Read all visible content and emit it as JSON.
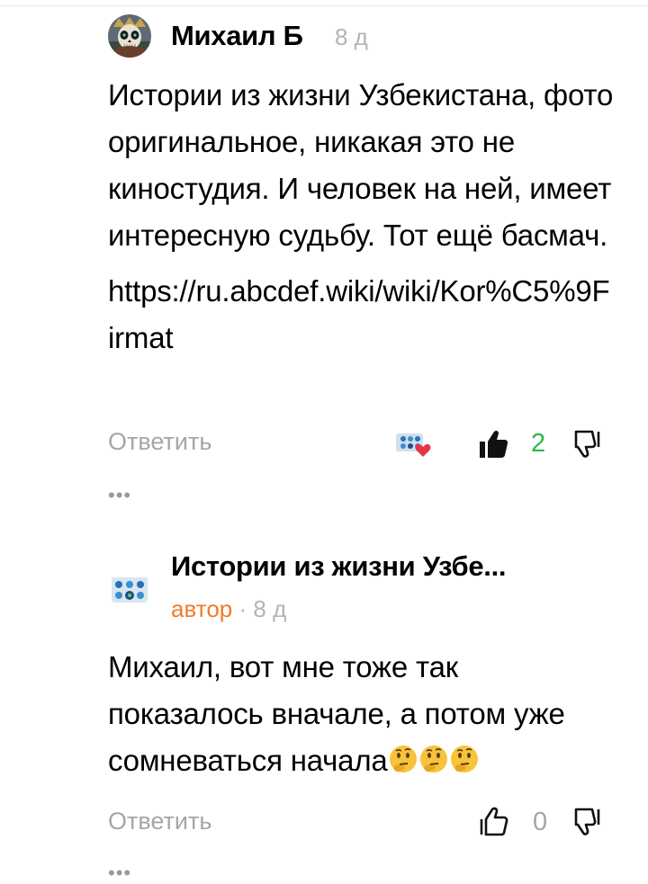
{
  "comments": [
    {
      "author": "Михаил Б",
      "time": "8 д",
      "paragraphs": [
        "Истории из жизни Узбекистана, фото оригинальное, никакая это не киностудия. И человек на ней, имеет интересную судьбу. Тот ещё басмач.",
        "https://ru.abcdef.wiki/wiki/Kor%C5%9Firmat"
      ],
      "reply_label": "Ответить",
      "likes": "2",
      "liked": true,
      "author_liked": true,
      "more": "•••"
    },
    {
      "author": "Истории из жизни Узбе...",
      "author_badge": "автор",
      "separator": "·",
      "time": "8 д",
      "text": "Михаил, вот мне тоже так показалось вначале, а потом уже сомневаться начала",
      "emojis": [
        "thinking-face-emoji",
        "thinking-face-emoji",
        "thinking-face-emoji"
      ],
      "reply_label": "Ответить",
      "likes": "0",
      "liked": false,
      "more": "•••"
    }
  ],
  "colors": {
    "like_active": "#2db84b",
    "author_badge": "#f07c2a",
    "muted": "#a6a6a6",
    "heart": "#e8334a"
  }
}
